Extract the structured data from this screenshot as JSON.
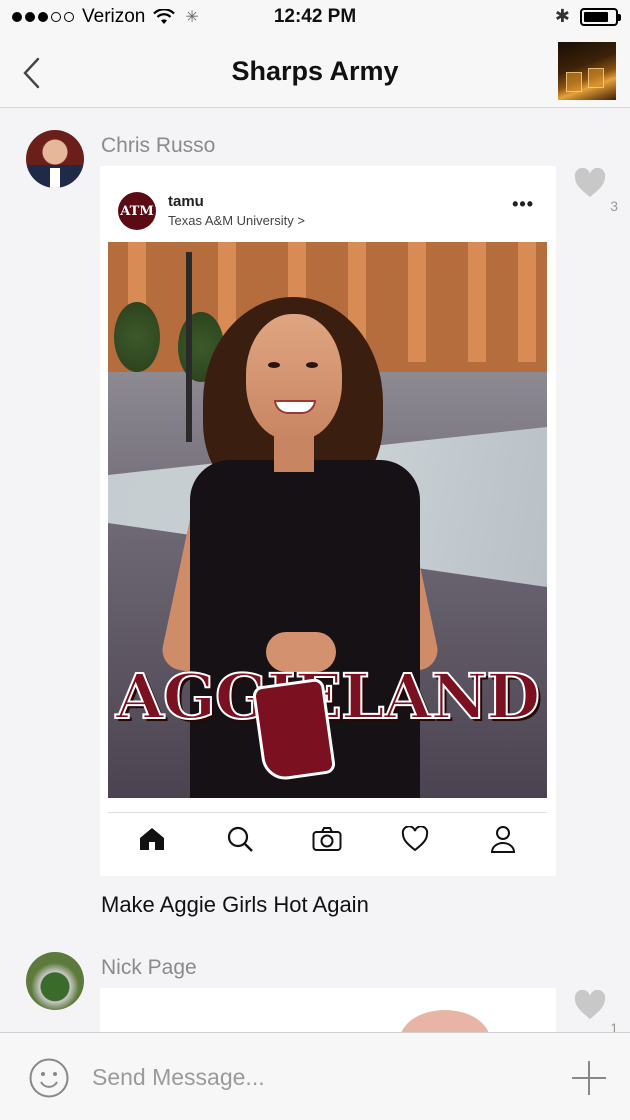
{
  "status_bar": {
    "carrier": "Verizon",
    "time": "12:42 PM",
    "signal_bars_filled": 3,
    "signal_bars_total": 5,
    "battery_level": 0.8
  },
  "nav": {
    "title": "Sharps Army",
    "back_icon": "chevron-left-icon",
    "thumbnail": "group-avatar-whiskey-glasses"
  },
  "posts": [
    {
      "author": "Chris Russo",
      "likes": "3",
      "shared_instagram": {
        "account": "tamu",
        "subtitle": "Texas A&M University >",
        "logo_text": "ATM",
        "overlay_text": "AGGIELAND",
        "nav_icons": [
          "home-icon",
          "search-icon",
          "camera-icon",
          "heart-icon",
          "profile-icon"
        ]
      },
      "caption": "Make Aggie Girls Hot Again"
    },
    {
      "author": "Nick Page",
      "likes": "1"
    }
  ],
  "composer": {
    "placeholder": "Send Message...",
    "emoji_icon": "smiley-icon",
    "add_icon": "plus-icon"
  },
  "colors": {
    "aggie_maroon": "#7a1020",
    "nav_background": "#f7f7f7",
    "feed_background": "#f4f4f6",
    "muted_text": "#8a8a8a"
  }
}
